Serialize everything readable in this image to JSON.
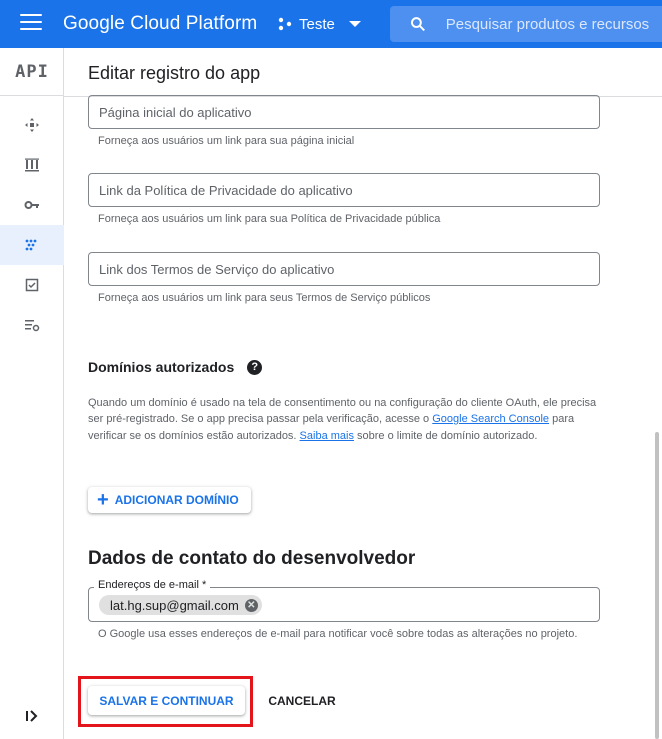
{
  "topbar": {
    "brand": "Google Cloud Platform",
    "project_name": "Teste",
    "search_placeholder": "Pesquisar produtos e recursos"
  },
  "sidebar": {
    "logo": "API",
    "items": [
      {
        "icon": "dashboard-icon"
      },
      {
        "icon": "library-icon"
      },
      {
        "icon": "key-icon"
      },
      {
        "icon": "consent-screen-icon",
        "active": true
      },
      {
        "icon": "checkbox-icon"
      },
      {
        "icon": "settings-list-icon"
      }
    ]
  },
  "page": {
    "title": "Editar registro do app"
  },
  "form": {
    "homepage_placeholder": "Página inicial do aplicativo",
    "homepage_hint": "Forneça aos usuários um link para sua página inicial",
    "privacy_placeholder": "Link da Política de Privacidade do aplicativo",
    "privacy_hint": "Forneça aos usuários um link para sua Política de Privacidade pública",
    "tos_placeholder": "Link dos Termos de Serviço do aplicativo",
    "tos_hint": "Forneça aos usuários um link para seus Termos de Serviço públicos"
  },
  "domains": {
    "title": "Domínios autorizados",
    "help": "?",
    "desc_1": "Quando um domínio é usado na tela de consentimento ou na configuração do cliente OAuth, ele precisa ser pré-registrado. Se o app precisa passar pela verificação, acesse o ",
    "link_console": "Google Search Console",
    "desc_2": " para verificar se os domínios estão autorizados. ",
    "link_more": "Saiba mais",
    "desc_3": " sobre o limite de domínio autorizado.",
    "add_label": "ADICIONAR DOMÍNIO"
  },
  "developer": {
    "title": "Dados de contato do desenvolvedor",
    "email_label": "Endereços de e-mail *",
    "email_chip": "lat.hg.sup@gmail.com",
    "email_hint": "O Google usa esses endereços de e-mail para notificar você sobre todas as alterações no projeto."
  },
  "actions": {
    "save": "SALVAR E CONTINUAR",
    "cancel": "CANCELAR"
  },
  "colors": {
    "primary": "#1a73e8",
    "highlight": "#e4141b"
  }
}
